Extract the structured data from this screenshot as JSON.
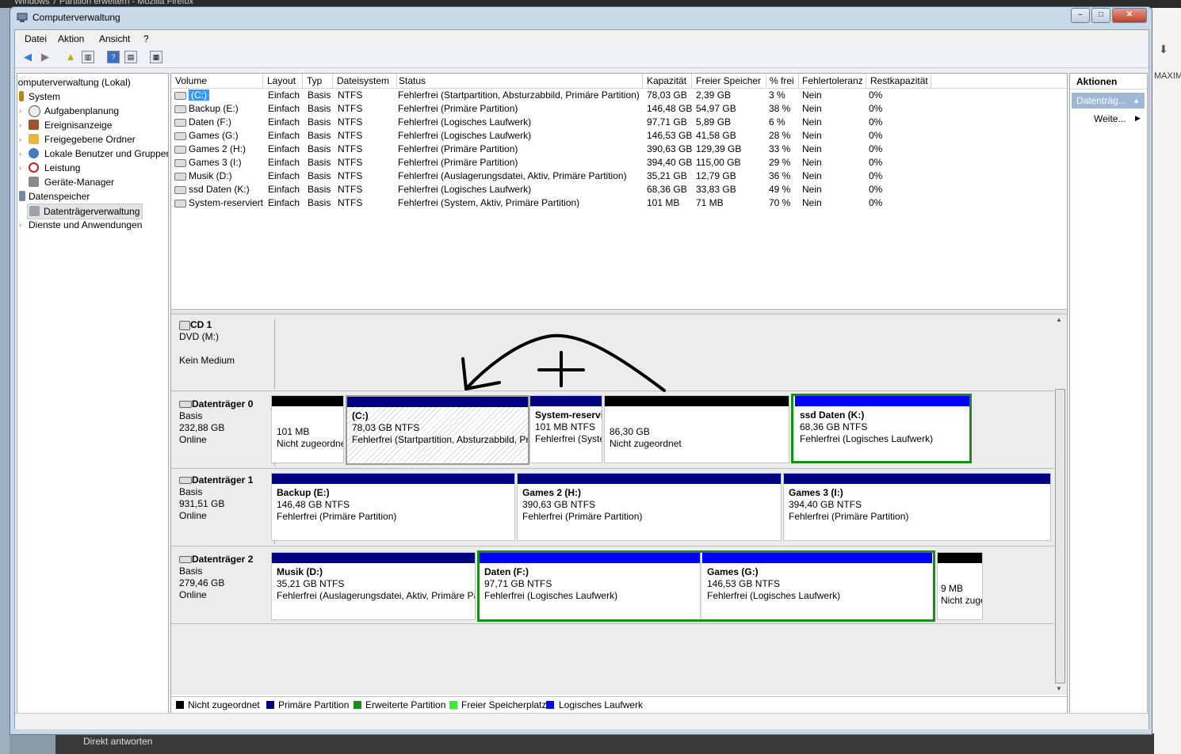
{
  "background": {
    "browser_title": "Windows 7 Partition erweitern - Mozilla Firefox",
    "right_label": "MAXIM",
    "bottom_link": "Direkt antworten"
  },
  "window": {
    "title": "Computerverwaltung",
    "buttons": {
      "minimize": "–",
      "maximize": "□",
      "close": "✕"
    }
  },
  "menu": {
    "file": "Datei",
    "action": "Aktion",
    "view": "Ansicht",
    "help": "?"
  },
  "tree": {
    "root": "Computerverwaltung (Lokal)",
    "items": [
      {
        "label": "System"
      },
      {
        "label": "Aufgabenplanung"
      },
      {
        "label": "Ereignisanzeige"
      },
      {
        "label": "Freigegebene Ordner"
      },
      {
        "label": "Lokale Benutzer und Gruppen"
      },
      {
        "label": "Leistung"
      },
      {
        "label": "Geräte-Manager"
      },
      {
        "label": "Datenspeicher"
      },
      {
        "label": "Datenträgerverwaltung"
      },
      {
        "label": "Dienste und Anwendungen"
      }
    ]
  },
  "volume_table": {
    "columns": [
      "Volume",
      "Layout",
      "Typ",
      "Dateisystem",
      "Status",
      "Kapazität",
      "Freier Speicher",
      "% frei",
      "Fehlertoleranz",
      "Restkapazität"
    ],
    "rows": [
      [
        "(C:)",
        "Einfach",
        "Basis",
        "NTFS",
        "Fehlerfrei (Startpartition, Absturzabbild, Primäre Partition)",
        "78,03 GB",
        "2,39 GB",
        "3 %",
        "Nein",
        "0%"
      ],
      [
        "Backup (E:)",
        "Einfach",
        "Basis",
        "NTFS",
        "Fehlerfrei (Primäre Partition)",
        "146,48 GB",
        "54,97 GB",
        "38 %",
        "Nein",
        "0%"
      ],
      [
        "Daten (F:)",
        "Einfach",
        "Basis",
        "NTFS",
        "Fehlerfrei (Logisches Laufwerk)",
        "97,71 GB",
        "5,89 GB",
        "6 %",
        "Nein",
        "0%"
      ],
      [
        "Games (G:)",
        "Einfach",
        "Basis",
        "NTFS",
        "Fehlerfrei (Logisches Laufwerk)",
        "146,53 GB",
        "41,58 GB",
        "28 %",
        "Nein",
        "0%"
      ],
      [
        "Games 2 (H:)",
        "Einfach",
        "Basis",
        "NTFS",
        "Fehlerfrei (Primäre Partition)",
        "390,63 GB",
        "129,39 GB",
        "33 %",
        "Nein",
        "0%"
      ],
      [
        "Games 3 (I:)",
        "Einfach",
        "Basis",
        "NTFS",
        "Fehlerfrei (Primäre Partition)",
        "394,40 GB",
        "115,00 GB",
        "29 %",
        "Nein",
        "0%"
      ],
      [
        "Musik (D:)",
        "Einfach",
        "Basis",
        "NTFS",
        "Fehlerfrei (Auslagerungsdatei, Aktiv, Primäre Partition)",
        "35,21 GB",
        "12,79 GB",
        "36 %",
        "Nein",
        "0%"
      ],
      [
        "ssd Daten (K:)",
        "Einfach",
        "Basis",
        "NTFS",
        "Fehlerfrei (Logisches Laufwerk)",
        "68,36 GB",
        "33,83 GB",
        "49 %",
        "Nein",
        "0%"
      ],
      [
        "System-reserviert",
        "Einfach",
        "Basis",
        "NTFS",
        "Fehlerfrei (System, Aktiv, Primäre Partition)",
        "101 MB",
        "71 MB",
        "70 %",
        "Nein",
        "0%"
      ]
    ]
  },
  "disks": {
    "cd1": {
      "name": "CD 1",
      "type": "DVD (M:)",
      "status": "Kein Medium"
    },
    "d0": {
      "name": "Datenträger 0",
      "type": "Basis",
      "size": "232,88 GB",
      "status": "Online",
      "p1": {
        "l1": "101 MB",
        "l2": "Nicht zugeordnet"
      },
      "p2": {
        "title": "(C:)",
        "l1": "78,03 GB NTFS",
        "l2": "Fehlerfrei (Startpartition, Absturzabbild, Primäre Partition)"
      },
      "p3": {
        "title": "System-reserviert",
        "l1": "101 MB NTFS",
        "l2": "Fehlerfrei (System, Aktiv, Primäre Partition)"
      },
      "p4": {
        "l1": "86,30 GB",
        "l2": "Nicht zugeordnet"
      },
      "p5": {
        "title": "ssd Daten  (K:)",
        "l1": "68,36 GB NTFS",
        "l2": "Fehlerfrei (Logisches Laufwerk)"
      }
    },
    "d1": {
      "name": "Datenträger 1",
      "type": "Basis",
      "size": "931,51 GB",
      "status": "Online",
      "p1": {
        "title": "Backup  (E:)",
        "l1": "146,48 GB NTFS",
        "l2": "Fehlerfrei (Primäre Partition)"
      },
      "p2": {
        "title": "Games 2  (H:)",
        "l1": "390,63 GB NTFS",
        "l2": "Fehlerfrei (Primäre Partition)"
      },
      "p3": {
        "title": "Games 3  (I:)",
        "l1": "394,40 GB NTFS",
        "l2": "Fehlerfrei (Primäre Partition)"
      }
    },
    "d2": {
      "name": "Datenträger 2",
      "type": "Basis",
      "size": "279,46 GB",
      "status": "Online",
      "p1": {
        "title": "Musik  (D:)",
        "l1": "35,21 GB NTFS",
        "l2": "Fehlerfrei (Auslagerungsdatei, Aktiv, Primäre Partition)"
      },
      "p2": {
        "title": "Daten  (F:)",
        "l1": "97,71 GB NTFS",
        "l2": "Fehlerfrei (Logisches Laufwerk)"
      },
      "p3": {
        "title": "Games  (G:)",
        "l1": "146,53 GB NTFS",
        "l2": "Fehlerfrei (Logisches Laufwerk)"
      },
      "p4": {
        "l1": "9 MB",
        "l2": "Nicht zugeordnet"
      }
    }
  },
  "legend": {
    "unallocated": "Nicht zugeordnet",
    "primary": "Primäre Partition",
    "extended": "Erweiterte Partition",
    "free": "Freier Speicherplatz",
    "logical": "Logisches Laufwerk"
  },
  "colors": {
    "unallocated": "#000000",
    "primary": "#000080",
    "extended": "#1a8c1a",
    "free": "#33ee33",
    "logical": "#0000ff"
  },
  "actions": {
    "header": "Aktionen",
    "section": "Datenträg...",
    "more": "Weite..."
  }
}
